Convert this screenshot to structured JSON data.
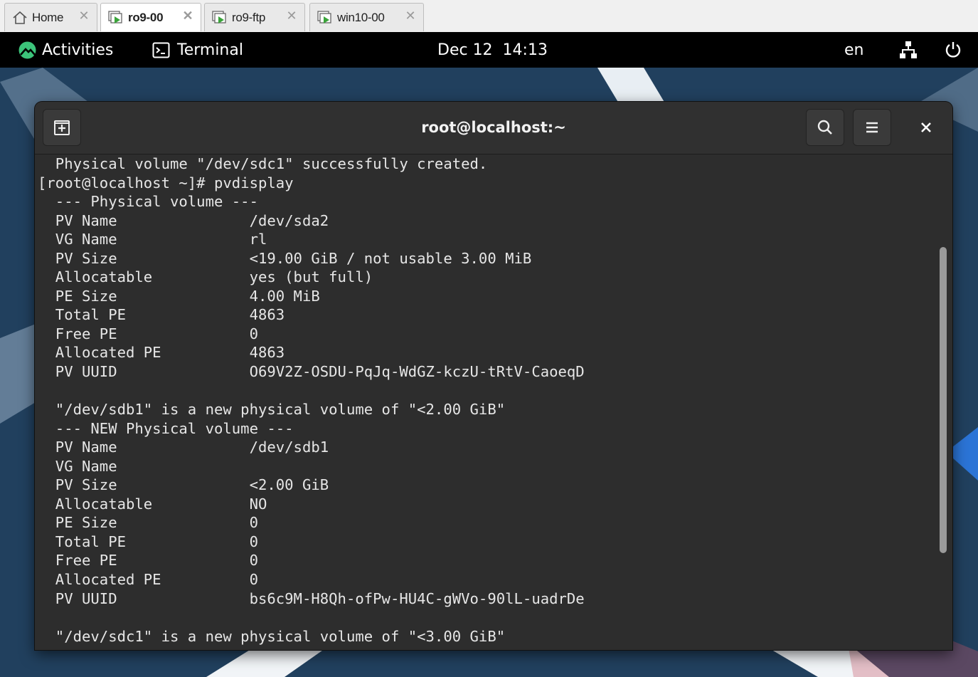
{
  "vm_tabs": [
    {
      "label": "Home",
      "icon": "home-icon",
      "active": false
    },
    {
      "label": "ro9-00",
      "icon": "vm-running-icon",
      "active": true
    },
    {
      "label": "ro9-ftp",
      "icon": "vm-running-icon",
      "active": false
    },
    {
      "label": "win10-00",
      "icon": "vm-running-icon",
      "active": false
    }
  ],
  "topbar": {
    "activities": "Activities",
    "app_name": "Terminal",
    "clock": "Dec 12  14:13",
    "keyboard_layout": "en"
  },
  "terminal": {
    "title": "root@localhost:~",
    "lines": [
      "  Physical volume \"/dev/sdc1\" successfully created.",
      "[root@localhost ~]# pvdisplay",
      "  --- Physical volume ---",
      "  PV Name               /dev/sda2",
      "  VG Name               rl",
      "  PV Size               <19.00 GiB / not usable 3.00 MiB",
      "  Allocatable           yes (but full)",
      "  PE Size               4.00 MiB",
      "  Total PE              4863",
      "  Free PE               0",
      "  Allocated PE          4863",
      "  PV UUID               O69V2Z-OSDU-PqJq-WdGZ-kczU-tRtV-CaoeqD",
      "",
      "  \"/dev/sdb1\" is a new physical volume of \"<2.00 GiB\"",
      "  --- NEW Physical volume ---",
      "  PV Name               /dev/sdb1",
      "  VG Name",
      "  PV Size               <2.00 GiB",
      "  Allocatable           NO",
      "  PE Size               0",
      "  Total PE              0",
      "  Free PE               0",
      "  Allocated PE          0",
      "  PV UUID               bs6c9M-H8Qh-ofPw-HU4C-gWVo-90lL-uadrDe",
      "",
      "  \"/dev/sdc1\" is a new physical volume of \"<3.00 GiB\""
    ]
  },
  "colors": {
    "topbar_bg": "#000000",
    "terminal_bg": "#2d2d2d",
    "terminal_fg": "#e6e6e6",
    "wallpaper": "#21405e",
    "accent_green": "#3cc37a"
  }
}
